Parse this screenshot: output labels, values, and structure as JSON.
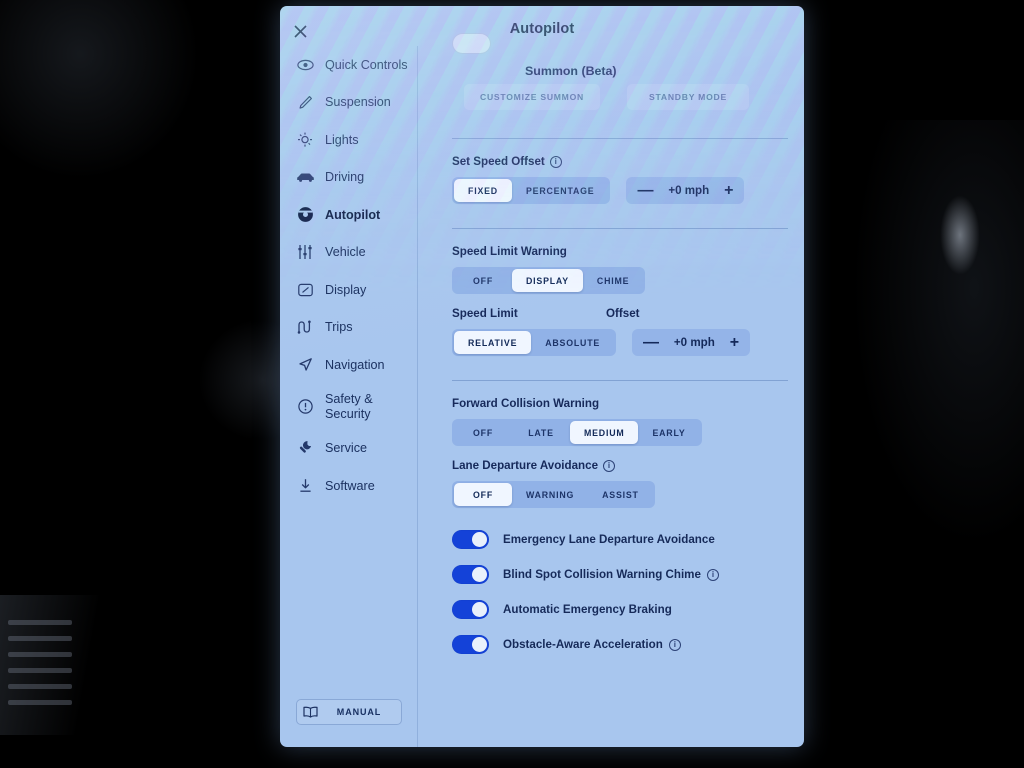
{
  "header": {
    "title": "Autopilot",
    "close_icon": "close-icon"
  },
  "sidebar": {
    "items": [
      {
        "label": "Quick Controls",
        "icon": "eye-icon",
        "active": false
      },
      {
        "label": "Suspension",
        "icon": "pencil-icon",
        "active": false
      },
      {
        "label": "Lights",
        "icon": "lightbulb-icon",
        "active": false
      },
      {
        "label": "Driving",
        "icon": "car-icon",
        "active": false
      },
      {
        "label": "Autopilot",
        "icon": "steering-wheel-icon",
        "active": true
      },
      {
        "label": "Vehicle",
        "icon": "sliders-icon",
        "active": false
      },
      {
        "label": "Display",
        "icon": "display-icon",
        "active": false
      },
      {
        "label": "Trips",
        "icon": "trips-icon",
        "active": false
      },
      {
        "label": "Navigation",
        "icon": "navigation-arrow-icon",
        "active": false
      },
      {
        "label": "Safety & Security",
        "icon": "exclamation-circle-icon",
        "active": false
      },
      {
        "label": "Service",
        "icon": "wrench-icon",
        "active": false
      },
      {
        "label": "Software",
        "icon": "download-icon",
        "active": false
      }
    ],
    "manual_button": {
      "label": "MANUAL",
      "icon": "book-icon"
    }
  },
  "content": {
    "summon": {
      "label": "Summon (Beta)",
      "toggle_on": false,
      "customize_label": "CUSTOMIZE SUMMON",
      "standby_label": "STANDBY MODE"
    },
    "set_speed_offset": {
      "label": "Set Speed Offset",
      "info_icon": "info-icon",
      "options": [
        "FIXED",
        "PERCENTAGE"
      ],
      "selected": "FIXED",
      "stepper": {
        "minus": "—",
        "plus": "+",
        "value": "+0 mph"
      }
    },
    "speed_limit_warning": {
      "label": "Speed Limit Warning",
      "options": [
        "OFF",
        "DISPLAY",
        "CHIME"
      ],
      "selected": "DISPLAY"
    },
    "speed_limit": {
      "label": "Speed Limit",
      "options": [
        "RELATIVE",
        "ABSOLUTE"
      ],
      "selected": "RELATIVE"
    },
    "speed_limit_offset": {
      "label": "Offset",
      "stepper": {
        "minus": "—",
        "plus": "+",
        "value": "+0 mph"
      }
    },
    "forward_collision_warning": {
      "label": "Forward Collision Warning",
      "options": [
        "OFF",
        "LATE",
        "MEDIUM",
        "EARLY"
      ],
      "selected": "MEDIUM"
    },
    "lane_departure_avoidance": {
      "label": "Lane Departure Avoidance",
      "info_icon": "info-icon",
      "options": [
        "OFF",
        "WARNING",
        "ASSIST"
      ],
      "selected": "OFF"
    },
    "toggles": [
      {
        "label": "Emergency Lane Departure Avoidance",
        "on": true,
        "info": false
      },
      {
        "label": "Blind Spot Collision Warning Chime",
        "on": true,
        "info": true
      },
      {
        "label": "Automatic Emergency Braking",
        "on": true,
        "info": false
      },
      {
        "label": "Obstacle-Aware Acceleration",
        "on": true,
        "info": true
      }
    ]
  },
  "colors": {
    "screen_bg": "#a8c6ee",
    "accent_blue": "#1442d8",
    "text_dark": "#16295a",
    "selected_pill": "#f0f6ff",
    "segment_track": "#7da0e1"
  }
}
